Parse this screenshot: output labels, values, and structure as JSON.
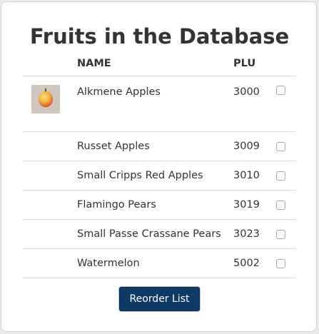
{
  "title": "Fruits in the Database",
  "table": {
    "headers": {
      "name": "NAME",
      "plu": "PLU"
    },
    "rows": [
      {
        "name": "Alkmene Apples",
        "plu": "3000",
        "checked": false,
        "image": "apple-image"
      },
      {
        "name": "Russet Apples",
        "plu": "3009",
        "checked": false
      },
      {
        "name": "Small Cripps Red Apples",
        "plu": "3010",
        "checked": false
      },
      {
        "name": "Flamingo Pears",
        "plu": "3019",
        "checked": false
      },
      {
        "name": "Small Passe Crassane Pears",
        "plu": "3023",
        "checked": false
      },
      {
        "name": "Watermelon",
        "plu": "5002",
        "checked": false
      }
    ]
  },
  "button": {
    "label": "Reorder List"
  },
  "colors": {
    "button_bg": "#0f3a66",
    "text": "#333333"
  }
}
